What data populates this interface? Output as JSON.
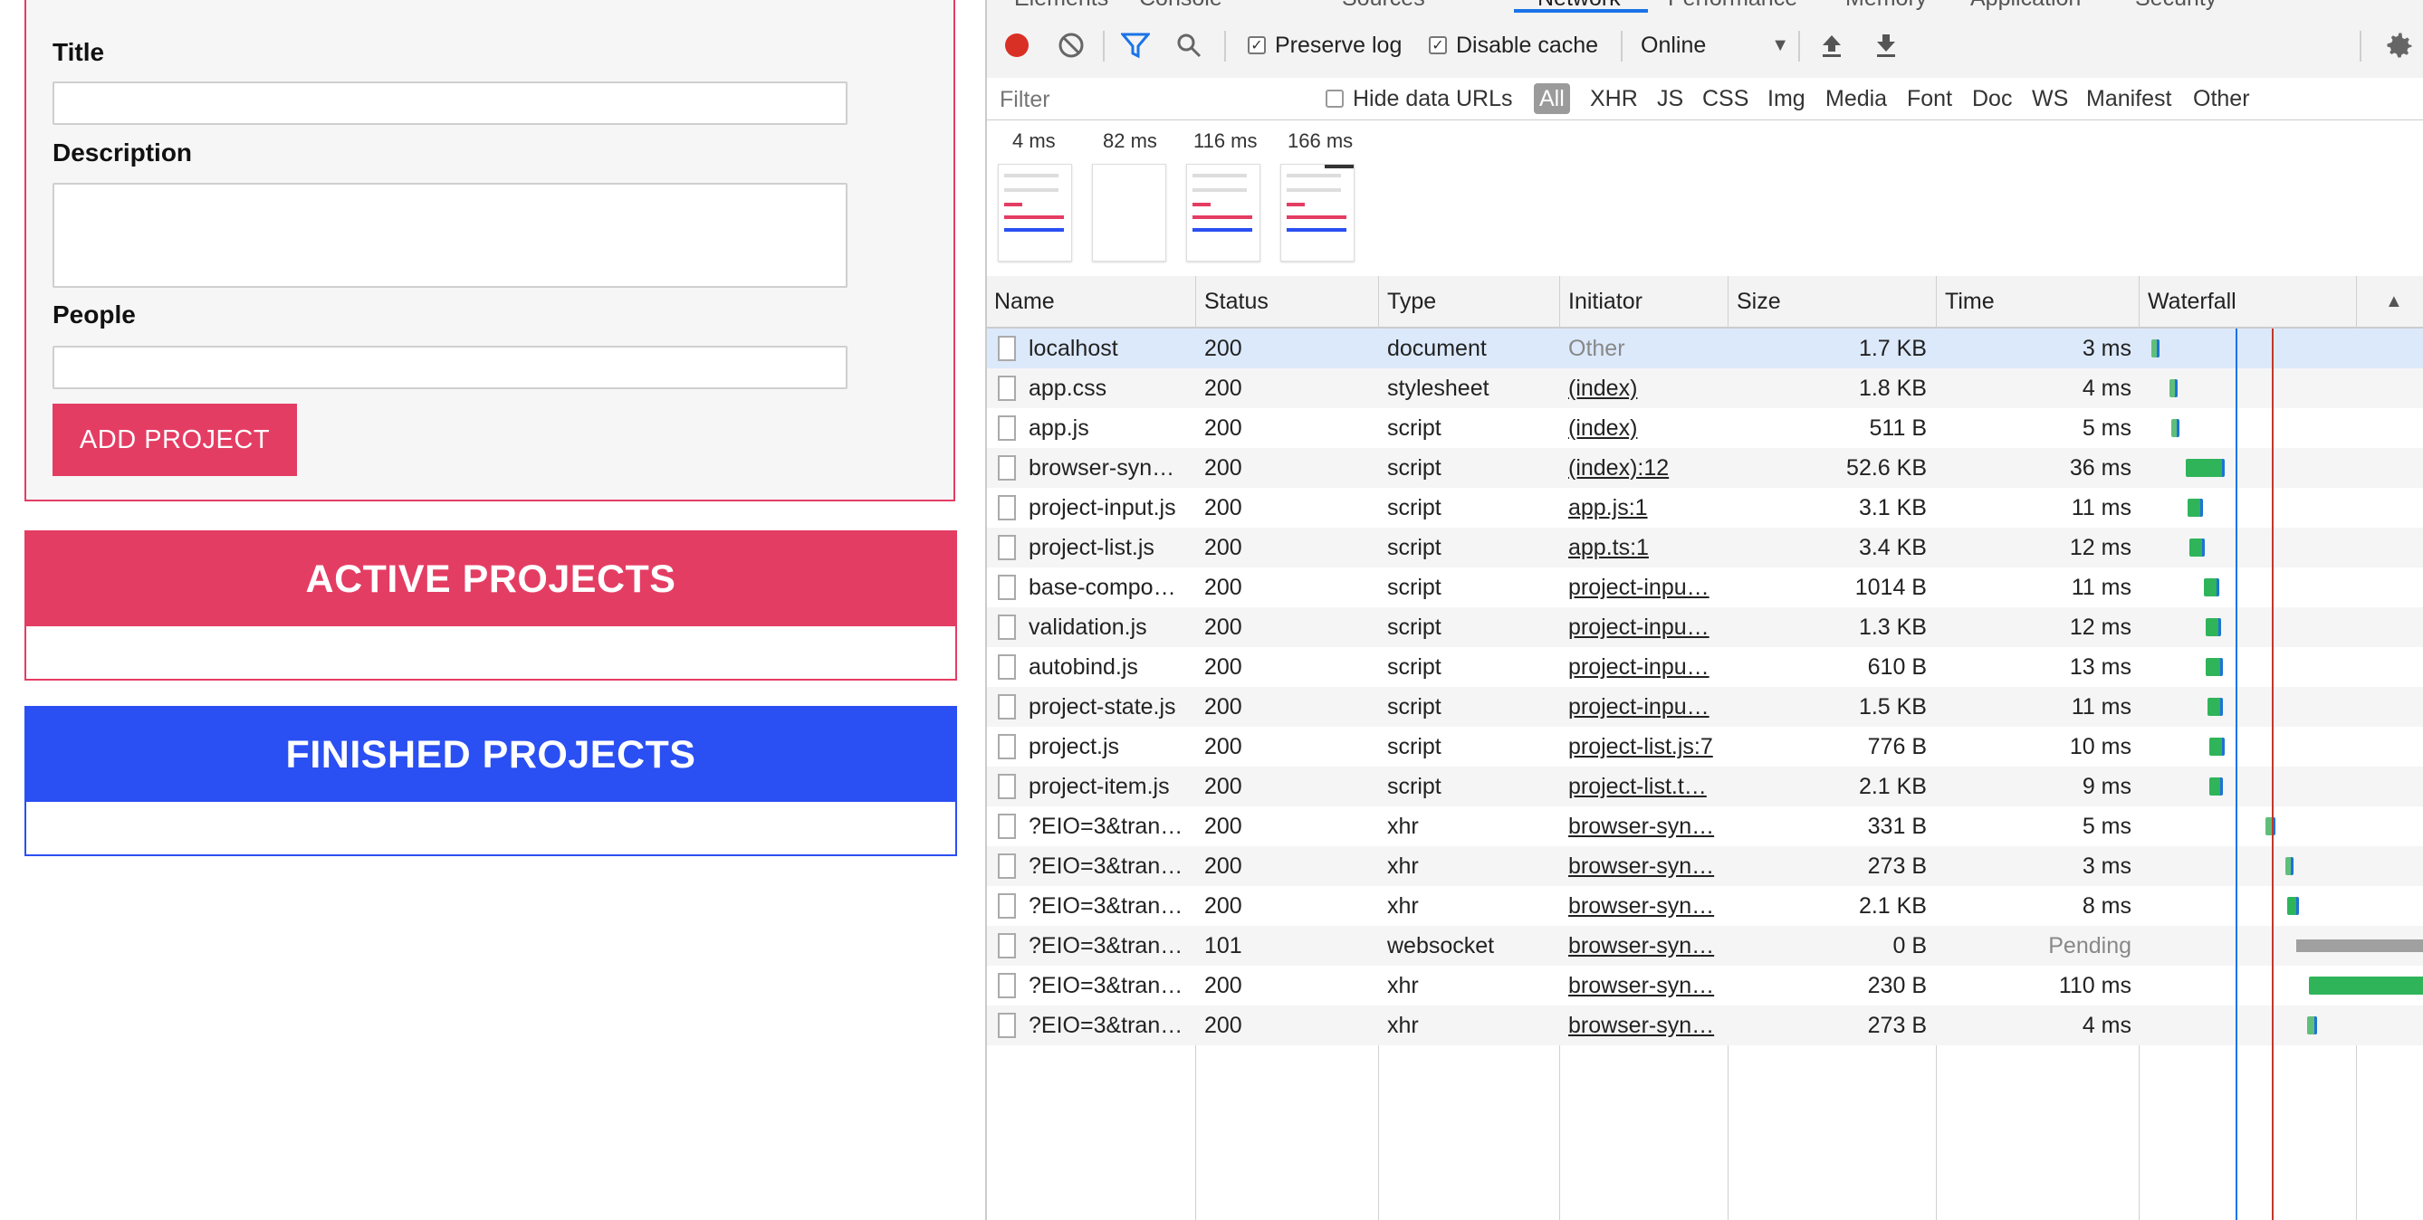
{
  "app": {
    "form": {
      "title_label": "Title",
      "description_label": "Description",
      "people_label": "People",
      "submit_label": "ADD PROJECT"
    },
    "active_heading": "ACTIVE PROJECTS",
    "finished_heading": "FINISHED PROJECTS"
  },
  "devtools": {
    "tabs": [
      "Elements",
      "Console",
      "Sources",
      "Network",
      "Performance",
      "Memory",
      "Application",
      "Security"
    ],
    "active_tab": "Network",
    "toolbar": {
      "preserve_log_label": "Preserve log",
      "preserve_log_checked": true,
      "disable_cache_label": "Disable cache",
      "disable_cache_checked": true,
      "throttle_value": "Online"
    },
    "filter": {
      "placeholder": "Filter",
      "hide_data_urls_label": "Hide data URLs",
      "types": [
        "All",
        "XHR",
        "JS",
        "CSS",
        "Img",
        "Media",
        "Font",
        "Doc",
        "WS",
        "Manifest",
        "Other"
      ],
      "active_type": "All"
    },
    "overview": {
      "times": [
        "4 ms",
        "82 ms",
        "116 ms",
        "166 ms"
      ]
    },
    "columns": {
      "name": "Name",
      "status": "Status",
      "type": "Type",
      "initiator": "Initiator",
      "size": "Size",
      "time": "Time",
      "waterfall": "Waterfall"
    },
    "rows": [
      {
        "name": "localhost",
        "status": "200",
        "type": "document",
        "initiator": "Other",
        "size": "1.7 KB",
        "time": "3 ms"
      },
      {
        "name": "app.css",
        "status": "200",
        "type": "stylesheet",
        "initiator": "(index)",
        "size": "1.8 KB",
        "time": "4 ms"
      },
      {
        "name": "app.js",
        "status": "200",
        "type": "script",
        "initiator": "(index)",
        "size": "511 B",
        "time": "5 ms"
      },
      {
        "name": "browser-syn…",
        "status": "200",
        "type": "script",
        "initiator": "(index):12",
        "size": "52.6 KB",
        "time": "36 ms"
      },
      {
        "name": "project-input.js",
        "status": "200",
        "type": "script",
        "initiator": "app.js:1",
        "size": "3.1 KB",
        "time": "11 ms"
      },
      {
        "name": "project-list.js",
        "status": "200",
        "type": "script",
        "initiator": "app.ts:1",
        "size": "3.4 KB",
        "time": "12 ms"
      },
      {
        "name": "base-compo…",
        "status": "200",
        "type": "script",
        "initiator": "project-inpu…",
        "size": "1014 B",
        "time": "11 ms"
      },
      {
        "name": "validation.js",
        "status": "200",
        "type": "script",
        "initiator": "project-inpu…",
        "size": "1.3 KB",
        "time": "12 ms"
      },
      {
        "name": "autobind.js",
        "status": "200",
        "type": "script",
        "initiator": "project-inpu…",
        "size": "610 B",
        "time": "13 ms"
      },
      {
        "name": "project-state.js",
        "status": "200",
        "type": "script",
        "initiator": "project-inpu…",
        "size": "1.5 KB",
        "time": "11 ms"
      },
      {
        "name": "project.js",
        "status": "200",
        "type": "script",
        "initiator": "project-list.js:7",
        "size": "776 B",
        "time": "10 ms"
      },
      {
        "name": "project-item.js",
        "status": "200",
        "type": "script",
        "initiator": "project-list.t…",
        "size": "2.1 KB",
        "time": "9 ms"
      },
      {
        "name": "?EIO=3&tran…",
        "status": "200",
        "type": "xhr",
        "initiator": "browser-syn…",
        "size": "331 B",
        "time": "5 ms"
      },
      {
        "name": "?EIO=3&tran…",
        "status": "200",
        "type": "xhr",
        "initiator": "browser-syn…",
        "size": "273 B",
        "time": "3 ms"
      },
      {
        "name": "?EIO=3&tran…",
        "status": "200",
        "type": "xhr",
        "initiator": "browser-syn…",
        "size": "2.1 KB",
        "time": "8 ms"
      },
      {
        "name": "?EIO=3&tran…",
        "status": "101",
        "type": "websocket",
        "initiator": "browser-syn…",
        "size": "0 B",
        "time": "Pending"
      },
      {
        "name": "?EIO=3&tran…",
        "status": "200",
        "type": "xhr",
        "initiator": "browser-syn…",
        "size": "230 B",
        "time": "110 ms"
      },
      {
        "name": "?EIO=3&tran…",
        "status": "200",
        "type": "xhr",
        "initiator": "browser-syn…",
        "size": "273 B",
        "time": "4 ms"
      }
    ],
    "colors": {
      "record": "#d93025",
      "accent": "#1a73e8",
      "waterfall_wait": "#2fb45a",
      "waterfall_recv": "#1f72d8",
      "pending": "#a0a0a0",
      "dom_line": "#1a73e8",
      "load_line": "#c0392b",
      "selected_row": "#dce9fb"
    }
  }
}
